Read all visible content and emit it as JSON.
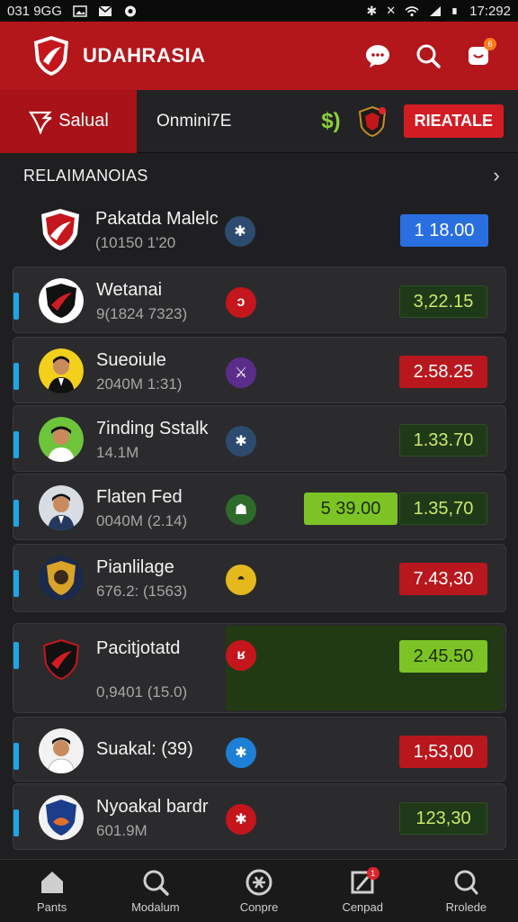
{
  "status": {
    "left_text": "031 9GG",
    "time": "17:292"
  },
  "app": {
    "title": "UDAHRASIA",
    "notification_count": "6"
  },
  "tabs": {
    "active_label": "Salual",
    "second_label": "Onmini7E",
    "currency_symbol": "$)",
    "action_label": "RIEATALE"
  },
  "section": {
    "title": "RELAIMANOIAS",
    "chevron": "›"
  },
  "rows": [
    {
      "name": "Pakatda Malelc",
      "meta": "(10150 1'20",
      "odds": "1 18.00",
      "odds_style": "blue"
    },
    {
      "name": "Wetanai",
      "meta": "9(1824  7323)",
      "odds": "3,22.15",
      "odds_style": "green"
    },
    {
      "name": "Sueoiule",
      "meta": "2040M   1:31)",
      "odds": "2.58.25",
      "odds_style": "red"
    },
    {
      "name": "7inding Sstalk",
      "meta": "14.1M",
      "odds": "1.33.70",
      "odds_style": "green"
    },
    {
      "name": "Flaten Fed",
      "meta": "0040M  (2.14)",
      "odds": "1.35,70",
      "odds_style": "green",
      "odds_extra": "5 39.00"
    },
    {
      "name": "Pianlilage",
      "meta": "676.2:  (1563)",
      "odds": "7.43,30",
      "odds_style": "red"
    },
    {
      "name": "Pacitjotatd",
      "meta": "0,9401   (15.0)",
      "odds": "2.45.50",
      "odds_style": "lime"
    },
    {
      "name": "Suakal: (39)",
      "meta": "",
      "odds": "1,53,00",
      "odds_style": "red"
    },
    {
      "name": "Nyoakal bardr",
      "meta": "601.9M",
      "odds": "123,30",
      "odds_style": "green"
    }
  ],
  "nav": [
    {
      "label": "Pants",
      "icon": "home-icon"
    },
    {
      "label": "Modalum",
      "icon": "search-icon"
    },
    {
      "label": "Conpre",
      "icon": "compare-icon"
    },
    {
      "label": "Cenpad",
      "icon": "flag-icon",
      "badge": "1"
    },
    {
      "label": "Rrolede",
      "icon": "chat-icon"
    }
  ]
}
